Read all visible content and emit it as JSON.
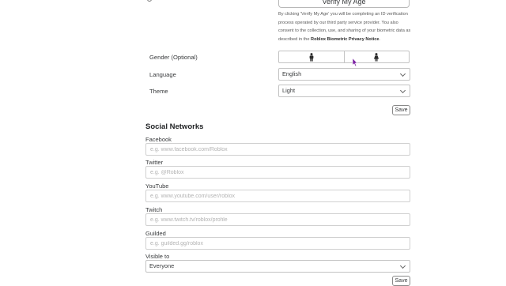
{
  "verify": {
    "button_label": "Verify My Age",
    "consent_text": "By clicking 'Verify My Age' you will be completing an ID verification process operated by our third party service provider. You also consent to the collection, use, and sharing of your biometric data as described in the ",
    "consent_link": "Roblox Biometric Privacy Notice",
    "consent_end": "."
  },
  "gender": {
    "label": "Gender (Optional)",
    "options": [
      "male-icon",
      "female-icon"
    ]
  },
  "language": {
    "label": "Language",
    "value": "English"
  },
  "theme": {
    "label": "Theme",
    "value": "Light"
  },
  "account_save_label": "Save",
  "social": {
    "title": "Social Networks",
    "facebook": {
      "label": "Facebook",
      "placeholder": "e.g. www.facebook.com/Roblox"
    },
    "twitter": {
      "label": "Twitter",
      "placeholder": "e.g. @Roblox"
    },
    "youtube": {
      "label": "YouTube",
      "placeholder": "e.g. www.youtube.com/user/roblox"
    },
    "twitch": {
      "label": "Twitch",
      "placeholder": "e.g. www.twitch.tv/roblox/profile"
    },
    "guilded": {
      "label": "Guilded",
      "placeholder": "e.g. guilded.gg/roblox"
    },
    "visible_to": {
      "label": "Visible to",
      "value": "Everyone"
    },
    "save_label": "Save"
  },
  "colors": {
    "text": "#393b3d",
    "border": "#c3c3c3",
    "placeholder": "#b3b3b3",
    "cursor": "#7a1fa2"
  }
}
